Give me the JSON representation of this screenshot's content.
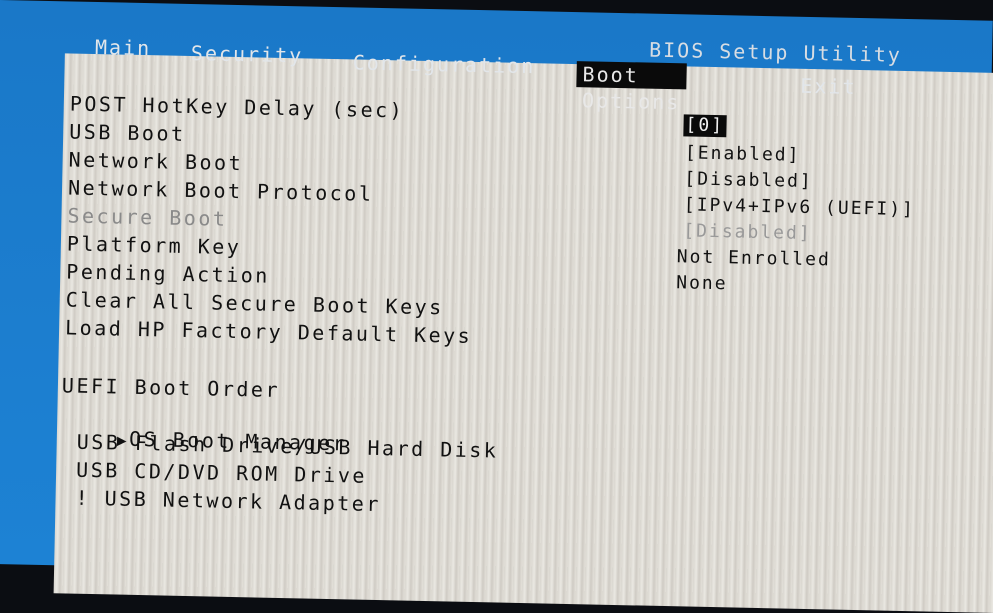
{
  "app_title": "BIOS Setup Utility",
  "menu": {
    "tabs": [
      {
        "label": "Main"
      },
      {
        "label": "Security"
      },
      {
        "label": "Configuration"
      },
      {
        "label": "Boot Options",
        "active": true
      },
      {
        "label": "Exit"
      }
    ]
  },
  "settings": [
    {
      "label": "POST HotKey Delay (sec)",
      "value": "[0]",
      "selected": true
    },
    {
      "label": "USB Boot",
      "value": "[Enabled]"
    },
    {
      "label": "Network Boot",
      "value": "[Disabled]"
    },
    {
      "label": "Network Boot Protocol",
      "value": "[IPv4+IPv6 (UEFI)]"
    },
    {
      "label": "Secure Boot",
      "value": "[Disabled]",
      "disabled": true
    },
    {
      "label": "Platform Key",
      "value": "Not Enrolled"
    },
    {
      "label": "Pending Action",
      "value": "None"
    },
    {
      "label": "Clear All Secure Boot Keys"
    },
    {
      "label": "Load HP Factory Default Keys"
    }
  ],
  "boot_order": {
    "heading": "UEFI Boot Order",
    "pointer_glyph": "▶",
    "items": [
      {
        "label": "OS Boot Manager",
        "current": true
      },
      {
        "label": "USB Flash Drive/USB Hard Disk"
      },
      {
        "label": "USB CD/DVD ROM Drive"
      },
      {
        "label": "! USB Network Adapter"
      }
    ]
  },
  "colors": {
    "header_blue": "#1a78c8",
    "panel_bg": "#e3e0d9",
    "highlight_bg": "#0a0a0a"
  }
}
